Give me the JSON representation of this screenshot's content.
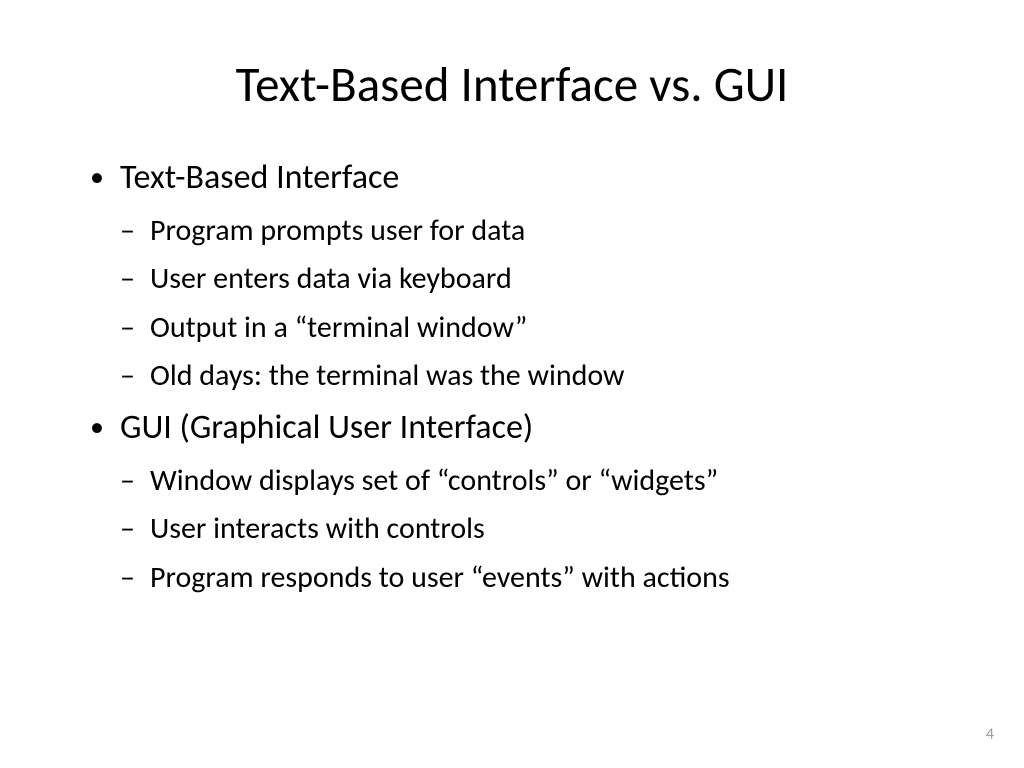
{
  "slide": {
    "title": "Text-Based Interface vs. GUI",
    "bullets": [
      {
        "text": "Text-Based Interface",
        "sub": [
          "Program prompts user for data",
          "User enters data via keyboard",
          "Output in a “terminal window”",
          "Old days: the terminal was the window"
        ]
      },
      {
        "text": "GUI (Graphical User Interface)",
        "sub": [
          "Window displays set of “controls” or “widgets”",
          "User interacts with controls",
          "Program responds to user “events” with actions"
        ]
      }
    ],
    "page_number": "4"
  }
}
